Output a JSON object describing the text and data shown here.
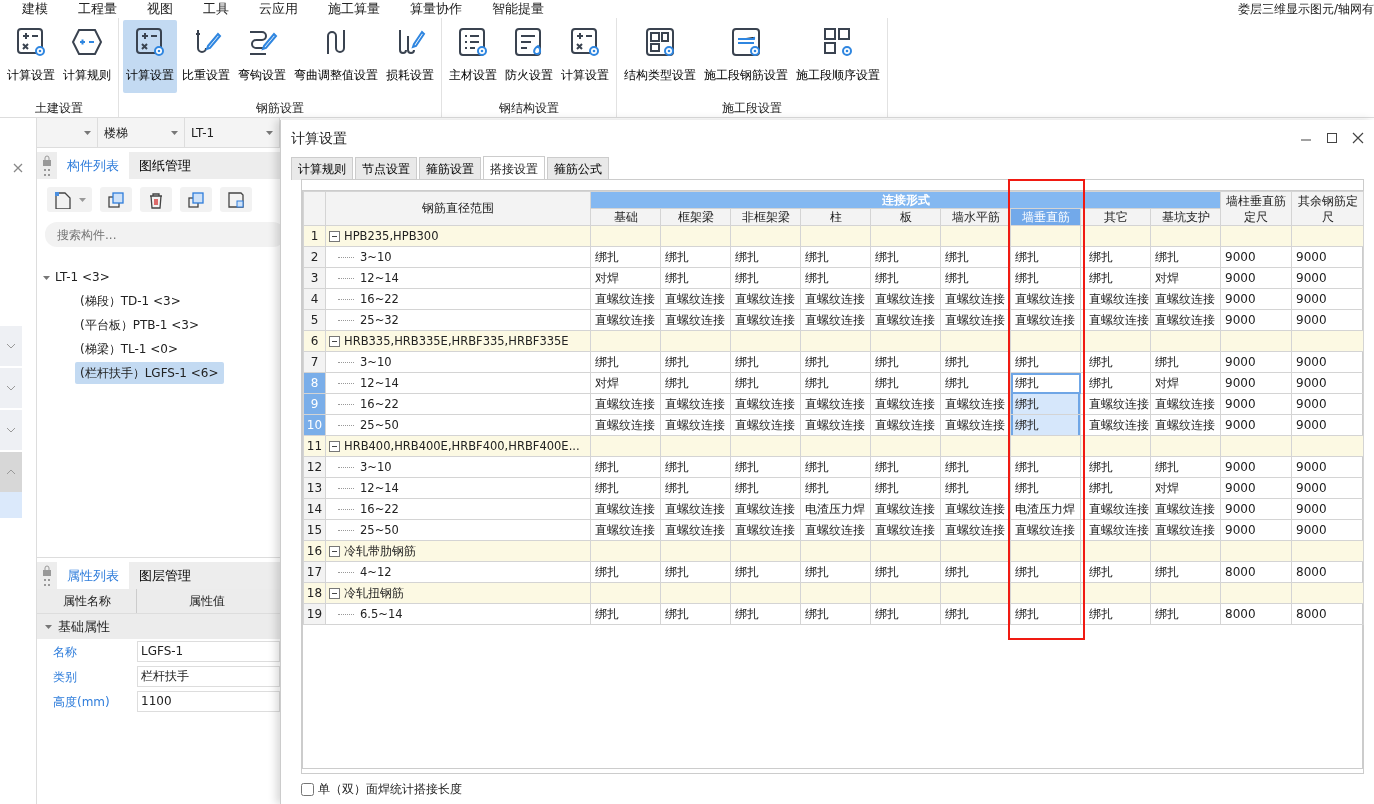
{
  "menu": [
    "建模",
    "工程量",
    "视图",
    "工具",
    "云应用",
    "施工算量",
    "算量协作",
    "智能提量"
  ],
  "status_text": "娄层三维显示图元/轴网有",
  "ribbon": [
    {
      "label": "土建设置",
      "buttons": [
        {
          "label": "计算设置",
          "selected": false
        },
        {
          "label": "计算规则",
          "selected": false
        }
      ]
    },
    {
      "label": "钢筋设置",
      "buttons": [
        {
          "label": "计算设置",
          "selected": true
        },
        {
          "label": "比重设置",
          "selected": false
        },
        {
          "label": "弯钩设置",
          "selected": false
        },
        {
          "label": "弯曲调整值设置",
          "selected": false
        },
        {
          "label": "损耗设置",
          "selected": false
        }
      ]
    },
    {
      "label": "钢结构设置",
      "buttons": [
        {
          "label": "主材设置",
          "selected": false
        },
        {
          "label": "防火设置",
          "selected": false
        },
        {
          "label": "计算设置",
          "selected": false
        }
      ]
    },
    {
      "label": "施工段设置",
      "buttons": [
        {
          "label": "结构类型设置",
          "selected": false
        },
        {
          "label": "施工段钢筋设置",
          "selected": false
        },
        {
          "label": "施工段顺序设置",
          "selected": false
        }
      ]
    }
  ],
  "selectors": [
    "楼梯",
    "LT-1"
  ],
  "component_panel": {
    "tabs": [
      {
        "label": "构件列表",
        "selected": true
      },
      {
        "label": "图纸管理",
        "selected": false
      }
    ],
    "search": {
      "placeholder": "搜索构件..."
    },
    "tree": [
      {
        "label": "LT-1 <3>",
        "expanded": true,
        "selected": false,
        "children": [
          {
            "label": "(梯段）TD-1 <3>",
            "selected": false
          },
          {
            "label": "(平台板）PTB-1 <3>",
            "selected": false
          },
          {
            "label": "(梯梁）TL-1 <0>",
            "selected": false
          },
          {
            "label": "(栏杆扶手）LGFS-1 <6>",
            "selected": true
          }
        ]
      }
    ]
  },
  "properties_panel": {
    "tabs": [
      {
        "label": "属性列表",
        "selected": true
      },
      {
        "label": "图层管理",
        "selected": false
      }
    ],
    "columns": [
      "属性名称",
      "属性值"
    ],
    "groups": [
      {
        "label": "基础属性",
        "expanded": true,
        "rows": [
          {
            "name": "名称",
            "value": "LGFS-1"
          },
          {
            "name": "类别",
            "value": "栏杆扶手"
          },
          {
            "name": "高度(mm)",
            "value": "1100"
          }
        ]
      }
    ]
  },
  "dialog": {
    "title": "计算设置",
    "tabs": [
      {
        "label": "计算规则",
        "selected": false
      },
      {
        "label": "节点设置",
        "selected": false
      },
      {
        "label": "箍筋设置",
        "selected": false
      },
      {
        "label": "搭接设置",
        "selected": true
      },
      {
        "label": "箍筋公式",
        "selected": false
      }
    ],
    "table": {
      "range_column": "钢筋直径范围",
      "header_group": "连接形式",
      "columns": [
        {
          "label": "基础",
          "selected": false,
          "annotated": false
        },
        {
          "label": "框架梁",
          "selected": false,
          "annotated": false
        },
        {
          "label": "非框架梁",
          "selected": false,
          "annotated": false
        },
        {
          "label": "柱",
          "selected": false,
          "annotated": false
        },
        {
          "label": "板",
          "selected": false,
          "annotated": false
        },
        {
          "label": "墙水平筋",
          "selected": false,
          "annotated": false
        },
        {
          "label": "墙垂直筋",
          "selected": true,
          "annotated": true
        },
        {
          "label": "其它",
          "selected": false,
          "annotated": false
        },
        {
          "label": "基坑支护",
          "selected": false,
          "annotated": false
        }
      ],
      "length_columns": [
        "墙柱垂直筋定尺",
        "其余钢筋定尺"
      ],
      "rows": [
        {
          "number": "1",
          "kind": "group",
          "range": "HPB235,HPB300",
          "expanded": true,
          "selected": false
        },
        {
          "number": "2",
          "kind": "item",
          "range": "3~10",
          "cells": [
            "绑扎",
            "绑扎",
            "绑扎",
            "绑扎",
            "绑扎",
            "绑扎",
            "绑扎",
            "绑扎",
            "绑扎"
          ],
          "lengths": [
            "9000",
            "9000"
          ],
          "selected": false
        },
        {
          "number": "3",
          "kind": "item",
          "range": "12~14",
          "cells": [
            "对焊",
            "绑扎",
            "绑扎",
            "绑扎",
            "绑扎",
            "绑扎",
            "绑扎",
            "绑扎",
            "对焊"
          ],
          "lengths": [
            "9000",
            "9000"
          ],
          "selected": false
        },
        {
          "number": "4",
          "kind": "item",
          "range": "16~22",
          "cells": [
            "直螺纹连接",
            "直螺纹连接",
            "直螺纹连接",
            "直螺纹连接",
            "直螺纹连接",
            "直螺纹连接",
            "直螺纹连接",
            "直螺纹连接",
            "直螺纹连接"
          ],
          "lengths": [
            "9000",
            "9000"
          ],
          "selected": false
        },
        {
          "number": "5",
          "kind": "item",
          "range": "25~32",
          "cells": [
            "直螺纹连接",
            "直螺纹连接",
            "直螺纹连接",
            "直螺纹连接",
            "直螺纹连接",
            "直螺纹连接",
            "直螺纹连接",
            "直螺纹连接",
            "直螺纹连接"
          ],
          "lengths": [
            "9000",
            "9000"
          ],
          "selected": false
        },
        {
          "number": "6",
          "kind": "group",
          "range": "HRB335,HRB335E,HRBF335,HRBF335E",
          "expanded": true,
          "selected": false
        },
        {
          "number": "7",
          "kind": "item",
          "range": "3~10",
          "cells": [
            "绑扎",
            "绑扎",
            "绑扎",
            "绑扎",
            "绑扎",
            "绑扎",
            "绑扎",
            "绑扎",
            "绑扎"
          ],
          "lengths": [
            "9000",
            "9000"
          ],
          "selected": false
        },
        {
          "number": "8",
          "kind": "item",
          "range": "12~14",
          "cells": [
            "对焊",
            "绑扎",
            "绑扎",
            "绑扎",
            "绑扎",
            "绑扎",
            "绑扎",
            "绑扎",
            "对焊"
          ],
          "lengths": [
            "9000",
            "9000"
          ],
          "selected": true,
          "focused": true
        },
        {
          "number": "9",
          "kind": "item",
          "range": "16~22",
          "cells": [
            "直螺纹连接",
            "直螺纹连接",
            "直螺纹连接",
            "直螺纹连接",
            "直螺纹连接",
            "直螺纹连接",
            "绑扎",
            "直螺纹连接",
            "直螺纹连接"
          ],
          "lengths": [
            "9000",
            "9000"
          ],
          "selected": true,
          "focused": false
        },
        {
          "number": "10",
          "kind": "item",
          "range": "25~50",
          "cells": [
            "直螺纹连接",
            "直螺纹连接",
            "直螺纹连接",
            "直螺纹连接",
            "直螺纹连接",
            "直螺纹连接",
            "绑扎",
            "直螺纹连接",
            "直螺纹连接"
          ],
          "lengths": [
            "9000",
            "9000"
          ],
          "selected": true,
          "focused": false
        },
        {
          "number": "11",
          "kind": "group",
          "range": "HRB400,HRB400E,HRBF400,HRBF400E...",
          "expanded": true,
          "selected": false
        },
        {
          "number": "12",
          "kind": "item",
          "range": "3~10",
          "cells": [
            "绑扎",
            "绑扎",
            "绑扎",
            "绑扎",
            "绑扎",
            "绑扎",
            "绑扎",
            "绑扎",
            "绑扎"
          ],
          "lengths": [
            "9000",
            "9000"
          ],
          "selected": false
        },
        {
          "number": "13",
          "kind": "item",
          "range": "12~14",
          "cells": [
            "绑扎",
            "绑扎",
            "绑扎",
            "绑扎",
            "绑扎",
            "绑扎",
            "绑扎",
            "绑扎",
            "对焊"
          ],
          "lengths": [
            "9000",
            "9000"
          ],
          "selected": false
        },
        {
          "number": "14",
          "kind": "item",
          "range": "16~22",
          "cells": [
            "直螺纹连接",
            "直螺纹连接",
            "直螺纹连接",
            "电渣压力焊",
            "直螺纹连接",
            "直螺纹连接",
            "电渣压力焊",
            "直螺纹连接",
            "直螺纹连接"
          ],
          "lengths": [
            "9000",
            "9000"
          ],
          "selected": false
        },
        {
          "number": "15",
          "kind": "item",
          "range": "25~50",
          "cells": [
            "直螺纹连接",
            "直螺纹连接",
            "直螺纹连接",
            "直螺纹连接",
            "直螺纹连接",
            "直螺纹连接",
            "直螺纹连接",
            "直螺纹连接",
            "直螺纹连接"
          ],
          "lengths": [
            "9000",
            "9000"
          ],
          "selected": false
        },
        {
          "number": "16",
          "kind": "group",
          "range": "冷轧带肋钢筋",
          "expanded": true,
          "selected": false
        },
        {
          "number": "17",
          "kind": "item",
          "range": "4~12",
          "cells": [
            "绑扎",
            "绑扎",
            "绑扎",
            "绑扎",
            "绑扎",
            "绑扎",
            "绑扎",
            "绑扎",
            "绑扎"
          ],
          "lengths": [
            "8000",
            "8000"
          ],
          "selected": false
        },
        {
          "number": "18",
          "kind": "group",
          "range": "冷轧扭钢筋",
          "expanded": true,
          "selected": false
        },
        {
          "number": "19",
          "kind": "item",
          "range": "6.5~14",
          "cells": [
            "绑扎",
            "绑扎",
            "绑扎",
            "绑扎",
            "绑扎",
            "绑扎",
            "绑扎",
            "绑扎",
            "绑扎"
          ],
          "lengths": [
            "8000",
            "8000"
          ],
          "selected": false
        }
      ]
    },
    "option": {
      "label": "单（双）面焊统计搭接长度",
      "checked": false
    }
  }
}
